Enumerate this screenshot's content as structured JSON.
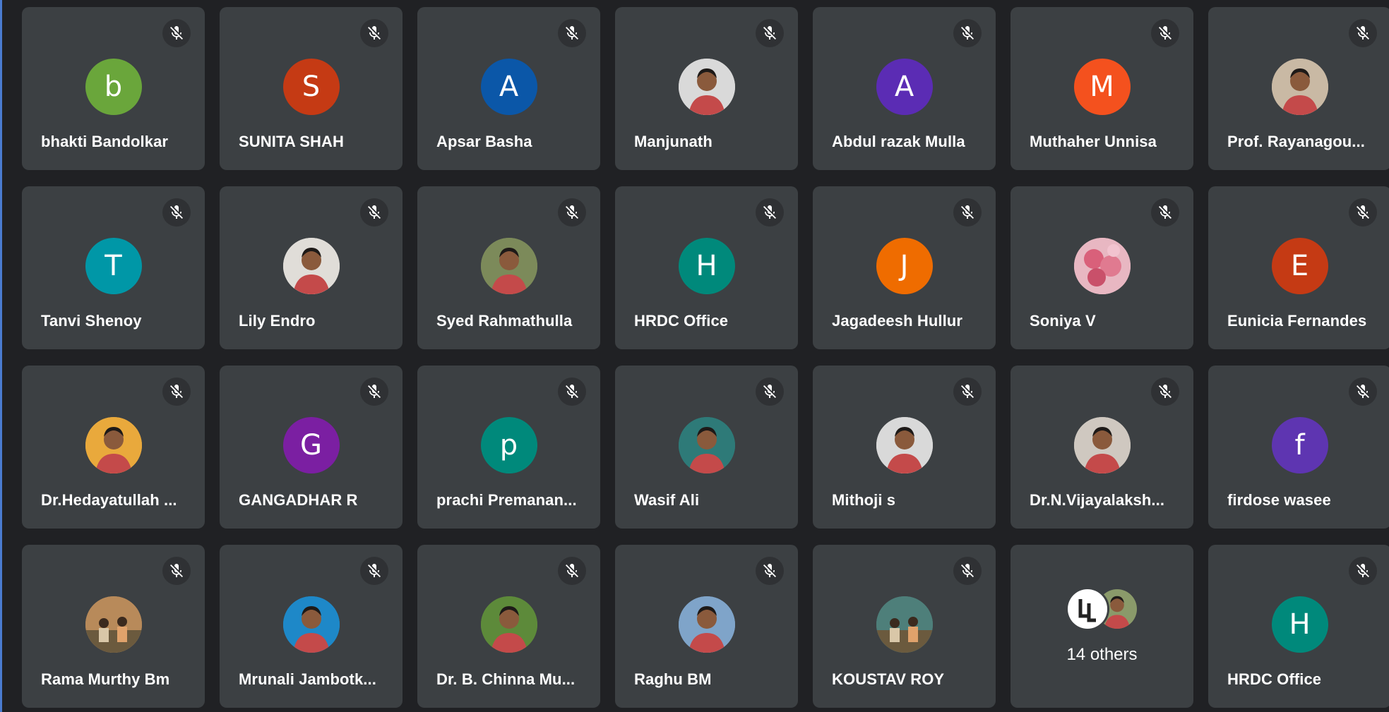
{
  "participants": [
    {
      "name": "bhakti Bandolkar",
      "initial": "b",
      "color": "#6aa63b",
      "photo": null
    },
    {
      "name": "SUNITA SHAH",
      "initial": "S",
      "color": "#c53a14",
      "photo": null
    },
    {
      "name": "Apsar Basha",
      "initial": "A",
      "color": "#0b57a8",
      "photo": null
    },
    {
      "name": "Manjunath",
      "initial": "",
      "color": "#d9d9d9",
      "photo": "person-photo"
    },
    {
      "name": "Abdul razak Mulla",
      "initial": "A",
      "color": "#5b2cb4",
      "photo": null
    },
    {
      "name": "Muthaher Unnisa",
      "initial": "M",
      "color": "#f4511e",
      "photo": null
    },
    {
      "name": "Prof. Rayanagou...",
      "initial": "",
      "color": "#c9b9a4",
      "photo": "person-photo"
    },
    {
      "name": "Tanvi Shenoy",
      "initial": "T",
      "color": "#0097a7",
      "photo": null
    },
    {
      "name": "Lily Endro",
      "initial": "",
      "color": "#e0ddd8",
      "photo": "person-photo"
    },
    {
      "name": "Syed Rahmathulla",
      "initial": "",
      "color": "#7c8a5a",
      "photo": "person-photo"
    },
    {
      "name": "HRDC Office",
      "initial": "H",
      "color": "#00897b",
      "photo": null
    },
    {
      "name": "Jagadeesh Hullur",
      "initial": "J",
      "color": "#ef6c00",
      "photo": null
    },
    {
      "name": "Soniya V",
      "initial": "",
      "color": "#e8b7c2",
      "photo": "flower-photo"
    },
    {
      "name": "Eunicia Fernandes",
      "initial": "E",
      "color": "#c53a14",
      "photo": null
    },
    {
      "name": "Dr.Hedayatullah ...",
      "initial": "",
      "color": "#e9a93c",
      "photo": "person-photo"
    },
    {
      "name": "GANGADHAR R",
      "initial": "G",
      "color": "#7b1fa2",
      "photo": null
    },
    {
      "name": "prachi Premanan...",
      "initial": "p",
      "color": "#00897b",
      "photo": null
    },
    {
      "name": "Wasif Ali",
      "initial": "",
      "color": "#2e7a78",
      "photo": "person-photo"
    },
    {
      "name": "Mithoji s",
      "initial": "",
      "color": "#d9d9d9",
      "photo": "person-photo"
    },
    {
      "name": "Dr.N.Vijayalaksh...",
      "initial": "",
      "color": "#cfc8c0",
      "photo": "person-photo"
    },
    {
      "name": "firdose wasee",
      "initial": "f",
      "color": "#5e35b1",
      "photo": null
    },
    {
      "name": "Rama Murthy Bm",
      "initial": "",
      "color": "#b88a5a",
      "photo": "group-photo"
    },
    {
      "name": "Mrunali Jambotk...",
      "initial": "",
      "color": "#1e88c8",
      "photo": "person-photo"
    },
    {
      "name": "Dr. B. Chinna Mu...",
      "initial": "",
      "color": "#5d8a3a",
      "photo": "person-photo"
    },
    {
      "name": "Raghu BM",
      "initial": "",
      "color": "#7fa4c9",
      "photo": "person-photo"
    },
    {
      "name": "KOUSTAV ROY",
      "initial": "",
      "color": "#4e7f7a",
      "photo": "group-photo"
    },
    {
      "name": "",
      "initial": "",
      "color": "",
      "photo": null,
      "others": true
    },
    {
      "name": "HRDC Office",
      "initial": "H",
      "color": "#00897b",
      "photo": null
    }
  ],
  "others_tile": {
    "label": "14 others",
    "avatars": [
      {
        "icon": "ll-logo-avatar",
        "color": "#ffffff"
      },
      {
        "icon": "person-photo",
        "color": "#8a9a6a"
      }
    ]
  },
  "icons": {
    "mute": "mic-off-icon"
  },
  "colors": {
    "background": "#202124",
    "tile": "#3c4043",
    "text": "#ffffff"
  }
}
